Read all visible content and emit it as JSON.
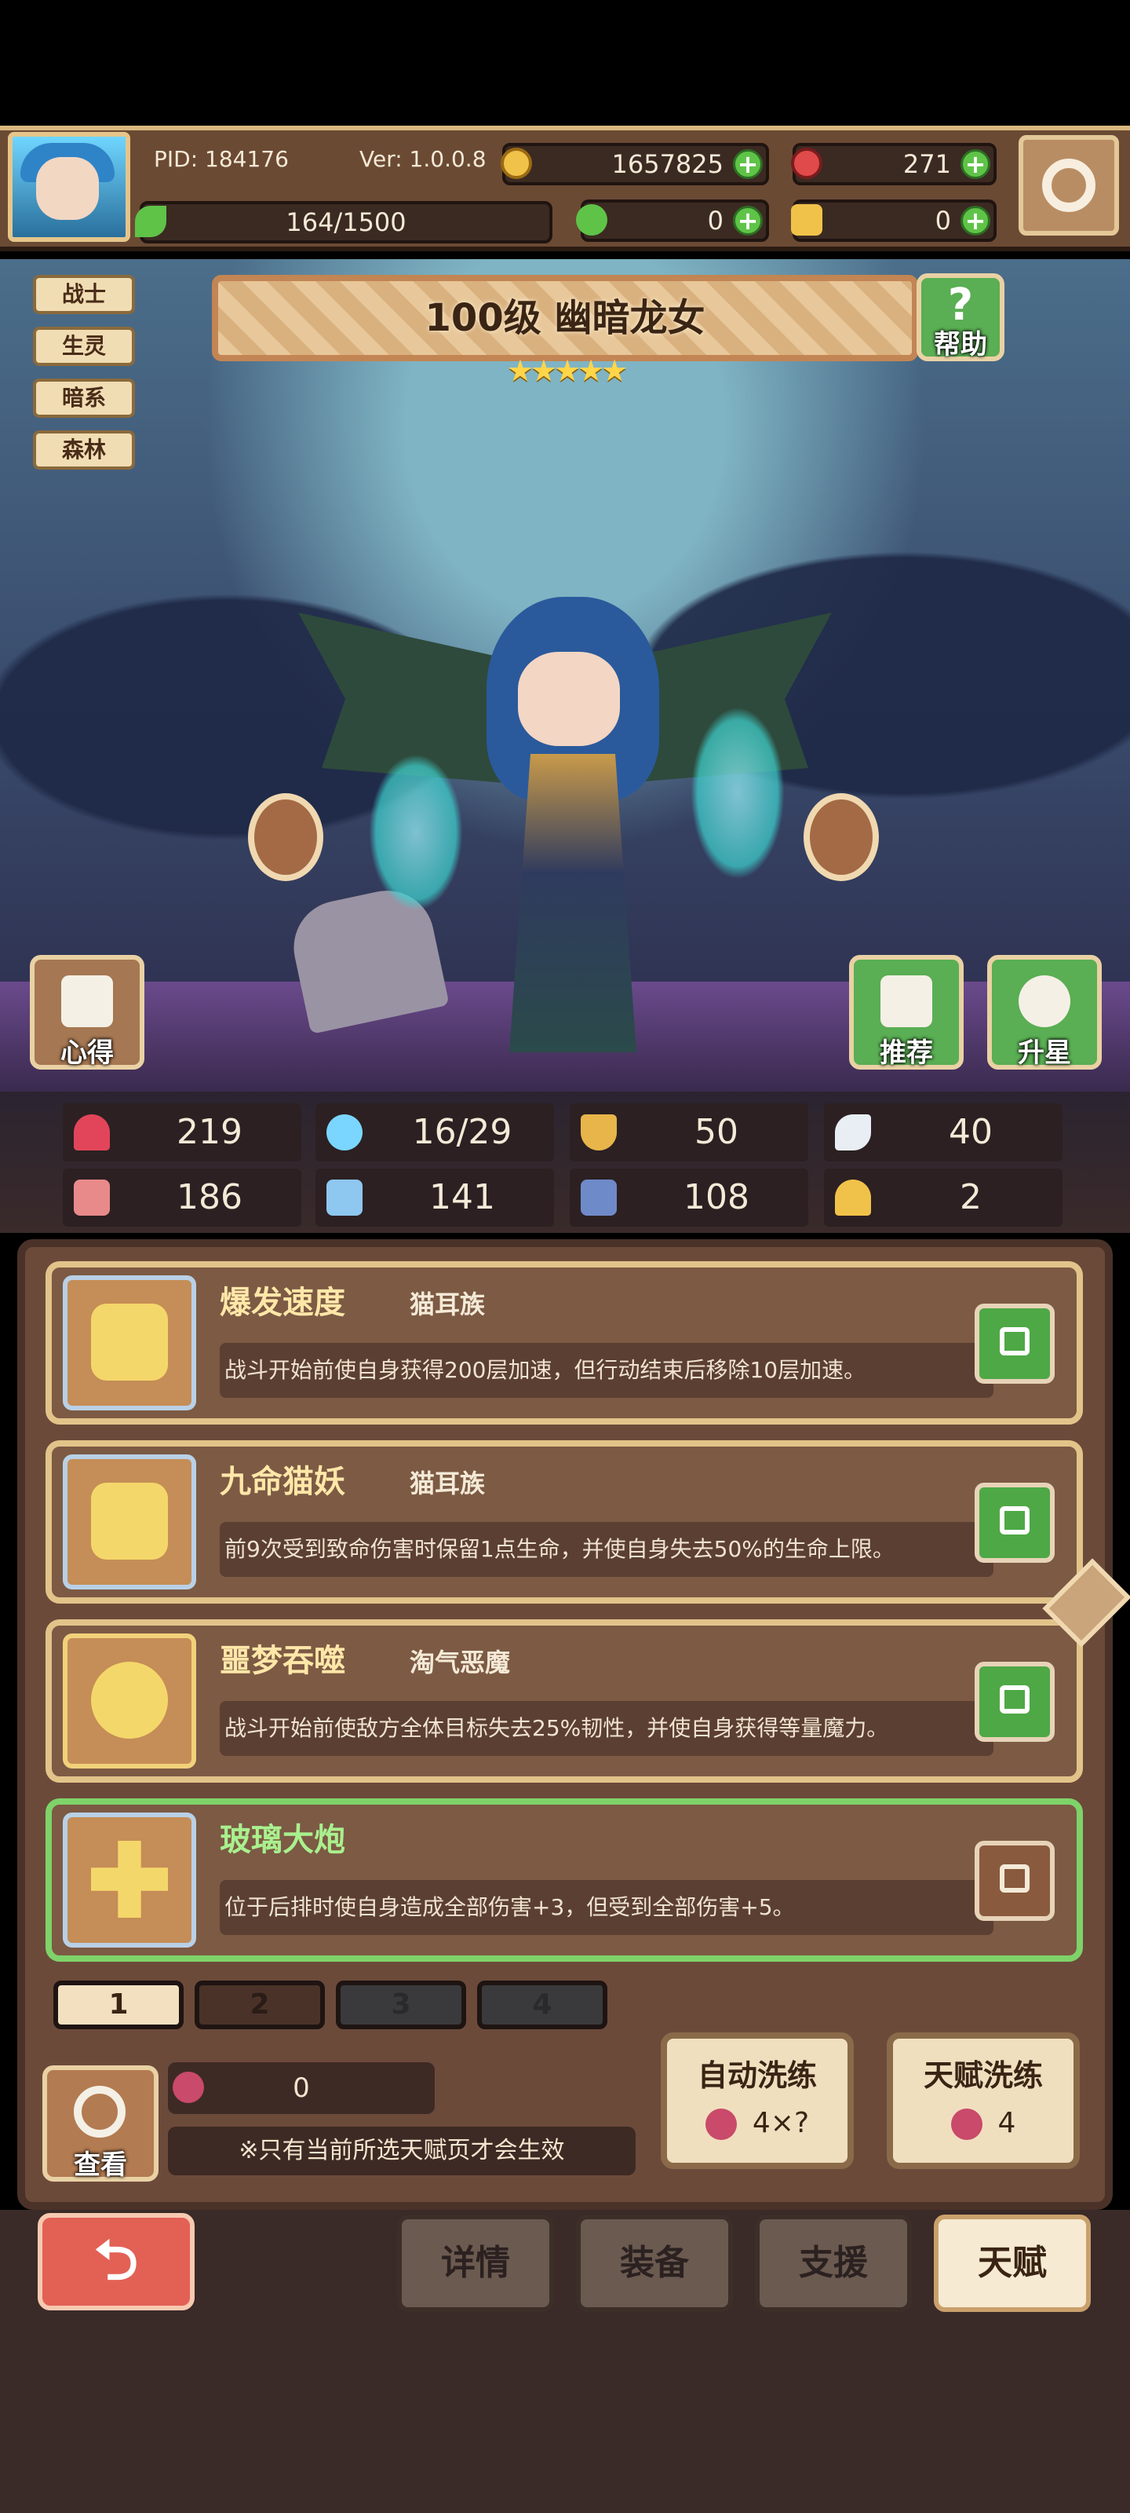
{
  "header": {
    "pid": "PID: 184176",
    "version": "Ver: 1.0.0.8",
    "gold": "1657825",
    "gems": "271",
    "stamina": "164/1500",
    "clover": "0",
    "key": "0"
  },
  "hero": {
    "tags": [
      "战士",
      "生灵",
      "暗系",
      "森林"
    ],
    "title": "100级 幽暗龙女",
    "stars": "★★★★★",
    "help_label": "帮助",
    "insight_label": "心得",
    "recommend_label": "推荐",
    "star_up_label": "升星"
  },
  "stats": [
    {
      "icon": "heart-icon",
      "value": "219"
    },
    {
      "icon": "water-drop-icon",
      "value": "16/29"
    },
    {
      "icon": "shield-icon",
      "value": "50"
    },
    {
      "icon": "wing-icon",
      "value": "40"
    },
    {
      "icon": "fist-icon",
      "value": "186"
    },
    {
      "icon": "book-icon",
      "value": "141"
    },
    {
      "icon": "boot-icon",
      "value": "108"
    },
    {
      "icon": "horseshoe-icon",
      "value": "2"
    }
  ],
  "talents": [
    {
      "name": "爆发速度",
      "race": "猫耳族",
      "desc": "战斗开始前使自身获得200层加速，但行动结束后移除10层加速。",
      "locked": true
    },
    {
      "name": "九命猫妖",
      "race": "猫耳族",
      "desc": "前9次受到致命伤害时保留1点生命，并使自身失去50%的生命上限。",
      "locked": true
    },
    {
      "name": "噩梦吞噬",
      "race": "淘气恶魔",
      "desc": "战斗开始前使敌方全体目标失去25%韧性，并使自身获得等量魔力。",
      "locked": true
    },
    {
      "name": "玻璃大炮",
      "race": "",
      "desc": "位于后排时使自身造成全部伤害+3，但受到全部伤害+5。",
      "locked": false
    }
  ],
  "pages": [
    "1",
    "2",
    "3",
    "4"
  ],
  "bottom_panel": {
    "view_label": "查看",
    "fruit_count": "0",
    "notice": "※只有当前所选天赋页才会生效",
    "auto_refine_label": "自动洗练",
    "auto_refine_cost": "4×?",
    "talent_refine_label": "天赋洗练",
    "talent_refine_cost": "4"
  },
  "nav": {
    "back": "⮌",
    "details": "详情",
    "equipment": "装备",
    "support": "支援",
    "talent": "天赋"
  }
}
